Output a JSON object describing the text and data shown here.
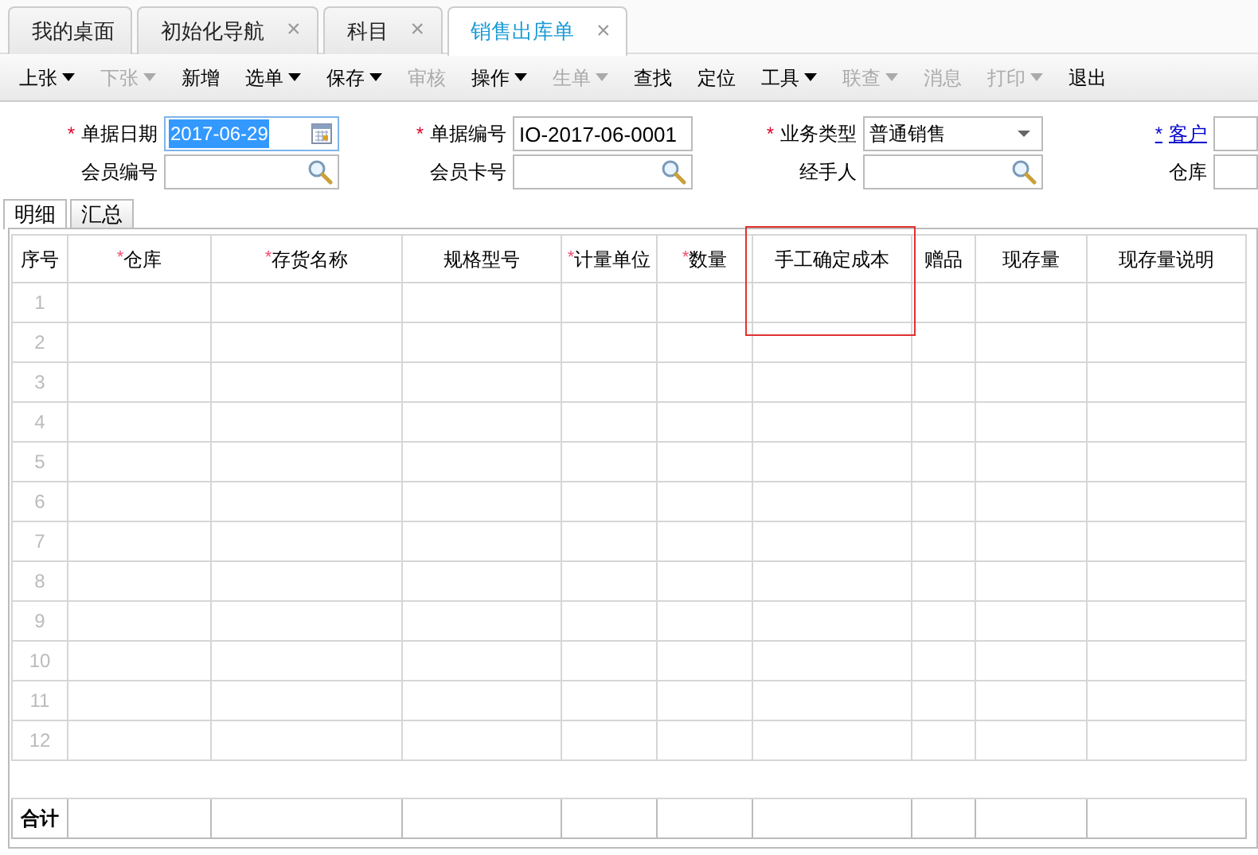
{
  "tabs": [
    {
      "label": "我的桌面",
      "selected": false,
      "closable": false
    },
    {
      "label": "初始化导航",
      "selected": false,
      "closable": true
    },
    {
      "label": "科目",
      "selected": false,
      "closable": true
    },
    {
      "label": "销售出库单",
      "selected": true,
      "closable": true
    }
  ],
  "tab_close_glyph": "×",
  "toolbar": [
    {
      "label": "上张",
      "disabled": false,
      "dropdown": true
    },
    {
      "label": "下张",
      "disabled": true,
      "dropdown": true
    },
    {
      "label": "新增",
      "disabled": false,
      "dropdown": false
    },
    {
      "label": "选单",
      "disabled": false,
      "dropdown": true
    },
    {
      "label": "保存",
      "disabled": false,
      "dropdown": true
    },
    {
      "label": "审核",
      "disabled": true,
      "dropdown": false
    },
    {
      "label": "操作",
      "disabled": false,
      "dropdown": true
    },
    {
      "label": "生单",
      "disabled": true,
      "dropdown": true
    },
    {
      "label": "查找",
      "disabled": false,
      "dropdown": false
    },
    {
      "label": "定位",
      "disabled": false,
      "dropdown": false
    },
    {
      "label": "工具",
      "disabled": false,
      "dropdown": true
    },
    {
      "label": "联查",
      "disabled": true,
      "dropdown": true
    },
    {
      "label": "消息",
      "disabled": true,
      "dropdown": false
    },
    {
      "label": "打印",
      "disabled": true,
      "dropdown": true
    },
    {
      "label": "退出",
      "disabled": false,
      "dropdown": false
    }
  ],
  "form_rows": [
    [
      {
        "label": "单据日期",
        "required": true,
        "link": false,
        "kind": "date",
        "value": "2017-06-29",
        "text_selected": true
      },
      {
        "label": "单据编号",
        "required": true,
        "link": false,
        "kind": "text",
        "value": "IO-2017-06-0001"
      },
      {
        "label": "业务类型",
        "required": true,
        "link": false,
        "kind": "select",
        "value": "普通销售"
      },
      {
        "label": "客户",
        "required": true,
        "link": true,
        "kind": "text"
      }
    ],
    [
      {
        "label": "会员编号",
        "required": false,
        "link": false,
        "kind": "lookup"
      },
      {
        "label": "会员卡号",
        "required": false,
        "link": false,
        "kind": "lookup"
      },
      {
        "label": "经手人",
        "required": false,
        "link": false,
        "kind": "lookup"
      },
      {
        "label": "仓库",
        "required": false,
        "link": false,
        "kind": "text"
      }
    ]
  ],
  "required_mark": "*",
  "sub_tabs": [
    {
      "label": "明细",
      "selected": true
    },
    {
      "label": "汇总",
      "selected": false
    }
  ],
  "grid": {
    "columns": [
      {
        "label": "序号",
        "required": false,
        "highlighted": false
      },
      {
        "label": "仓库",
        "required": true,
        "highlighted": false
      },
      {
        "label": "存货名称",
        "required": true,
        "highlighted": false
      },
      {
        "label": "规格型号",
        "required": false,
        "highlighted": false
      },
      {
        "label": "计量单位",
        "required": true,
        "highlighted": false
      },
      {
        "label": "数量",
        "required": true,
        "highlighted": false
      },
      {
        "label": "手工确定成本",
        "required": false,
        "highlighted": true
      },
      {
        "label": "赠品",
        "required": false,
        "highlighted": false
      },
      {
        "label": "现存量",
        "required": false,
        "highlighted": false
      },
      {
        "label": "现存量说明",
        "required": false,
        "highlighted": false
      }
    ],
    "row_numbers": [
      "1",
      "2",
      "3",
      "4",
      "5",
      "6",
      "7",
      "8",
      "9",
      "10",
      "11",
      "12"
    ],
    "total_label": "合计"
  }
}
